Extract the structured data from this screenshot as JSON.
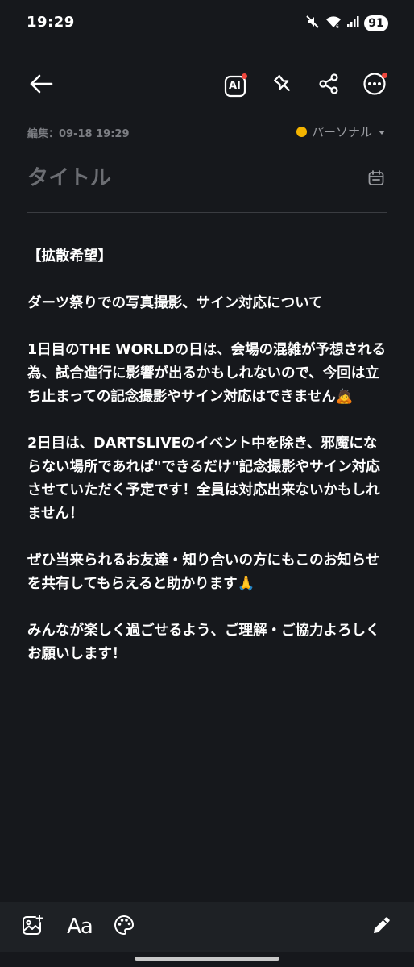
{
  "status_bar": {
    "time": "19:29",
    "battery": "91",
    "icons": [
      "mute-icon",
      "wifi-icon",
      "signal-icon"
    ]
  },
  "toolbar": {
    "back_icon": "arrow-left-icon",
    "ai_label": "AI",
    "pin_icon": "pin-icon",
    "share_icon": "share-icon",
    "more_icon": "more-icon",
    "notification_color": "#f0483e"
  },
  "meta": {
    "edited": "編集：09-18 19:29",
    "folder": "パーソナル",
    "folder_color": "#f4b400"
  },
  "title": {
    "placeholder": "タイトル",
    "value": ""
  },
  "note": {
    "paragraphs": [
      "【拡散希望】",
      "ダーツ祭りでの写真撮影、サイン対応について",
      "1日目のTHE WORLDの日は、会場の混雑が予想される為、試合進行に影響が出るかもしれないので、今回は立ち止まっての記念撮影やサイン対応はできません🙇",
      "2日目は、DARTSLIVEのイベント中を除き、邪魔にならない場所であれば\"できるだけ\"記念撮影やサイン対応させていただく予定です！全員は対応出来ないかもしれません！",
      "ぜひ当来られるお友達・知り合いの方にもこのお知らせを共有してもらえると助かります🙏",
      "みんなが楽しく過ごせるよう、ご理解・ご協力よろしくお願いします！"
    ]
  },
  "bottom_bar": {
    "text_format_label": "Aa",
    "icons": [
      "image-add-icon",
      "text-format-icon",
      "palette-icon",
      "pen-icon"
    ]
  },
  "colors": {
    "background": "#16181c",
    "bottom_bar": "#1e2125",
    "text": "#ffffff",
    "muted": "#7c7e83"
  }
}
